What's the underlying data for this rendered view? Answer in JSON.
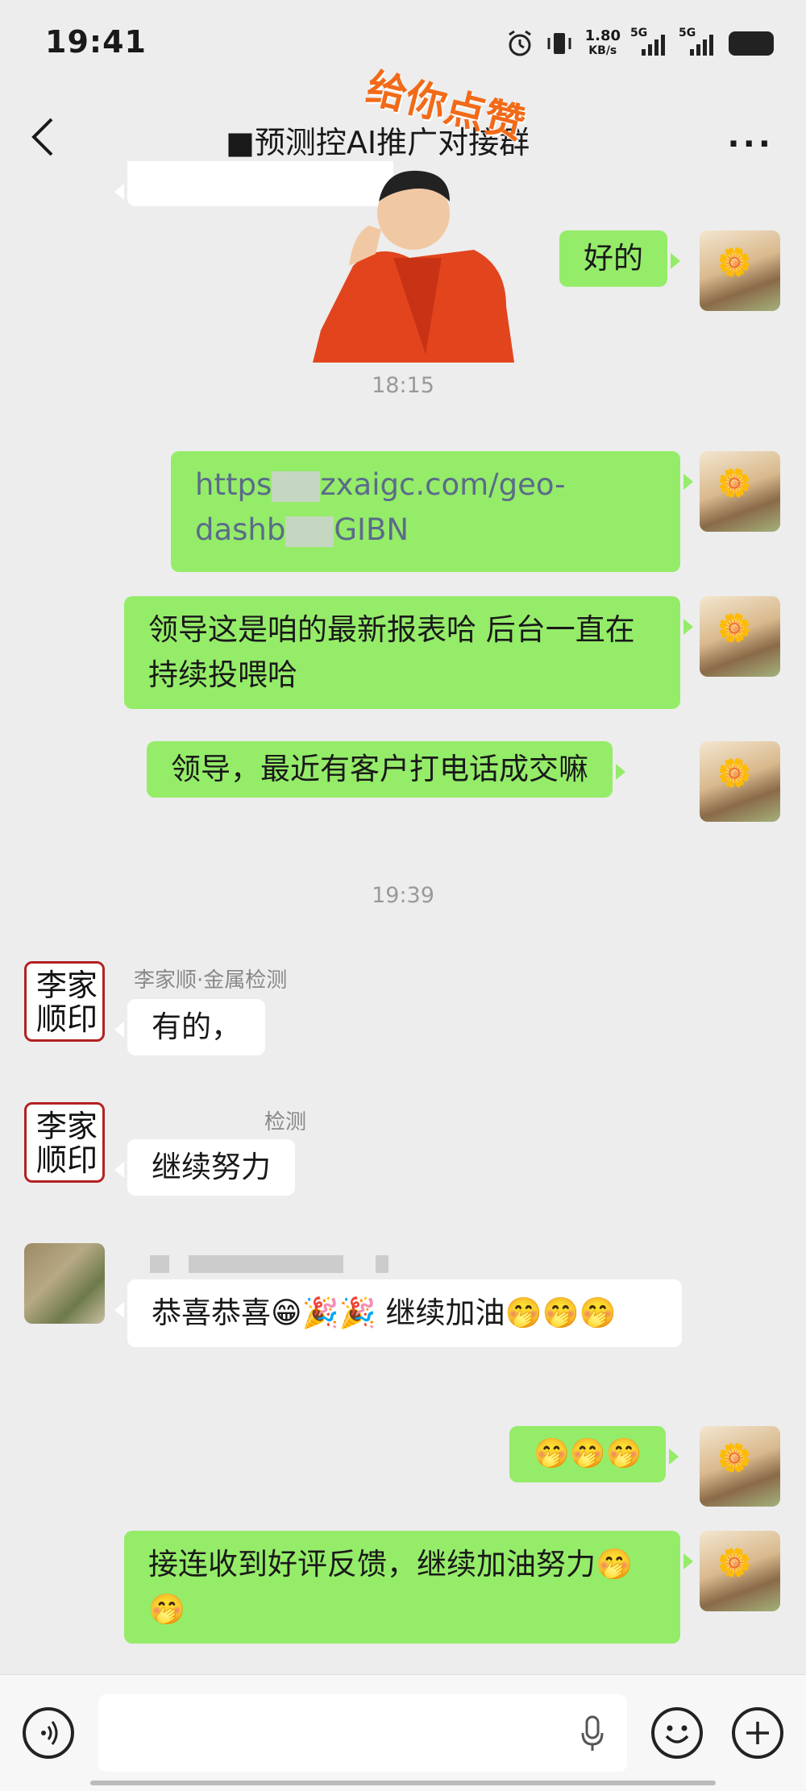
{
  "status_bar": {
    "time": "19:41",
    "speed_value": "1.80",
    "speed_unit": "KB/s",
    "sim1": "5G",
    "sim2": "5G"
  },
  "header": {
    "title": "■预测控AI推广对接群",
    "sticker_text": "给你点赞",
    "more": "···"
  },
  "timestamps": [
    "18:15",
    "19:39"
  ],
  "messages": {
    "ok": "好的",
    "link_part1": "https",
    "link_part2": "zxaigc.com/geo-",
    "link_part3": "dashb",
    "link_part4": "GIBN",
    "report": "领导这是咱的最新报表哈 后台一直在持续投喂哈",
    "question": "领导，最近有客户打电话成交嘛",
    "reply1_sender": "李家顺·金属检测",
    "reply1": "有的，",
    "reply2_sender": "检测",
    "reply2": "继续努力",
    "congrats": "恭喜恭喜😁🎉🎉  继续加油🤭🤭🤭",
    "cheer": "🤭🤭🤭",
    "final": "接连收到好评反馈，继续加油努力🤭🤭"
  },
  "seal_text": "李家顺印",
  "input": {
    "placeholder": ""
  }
}
